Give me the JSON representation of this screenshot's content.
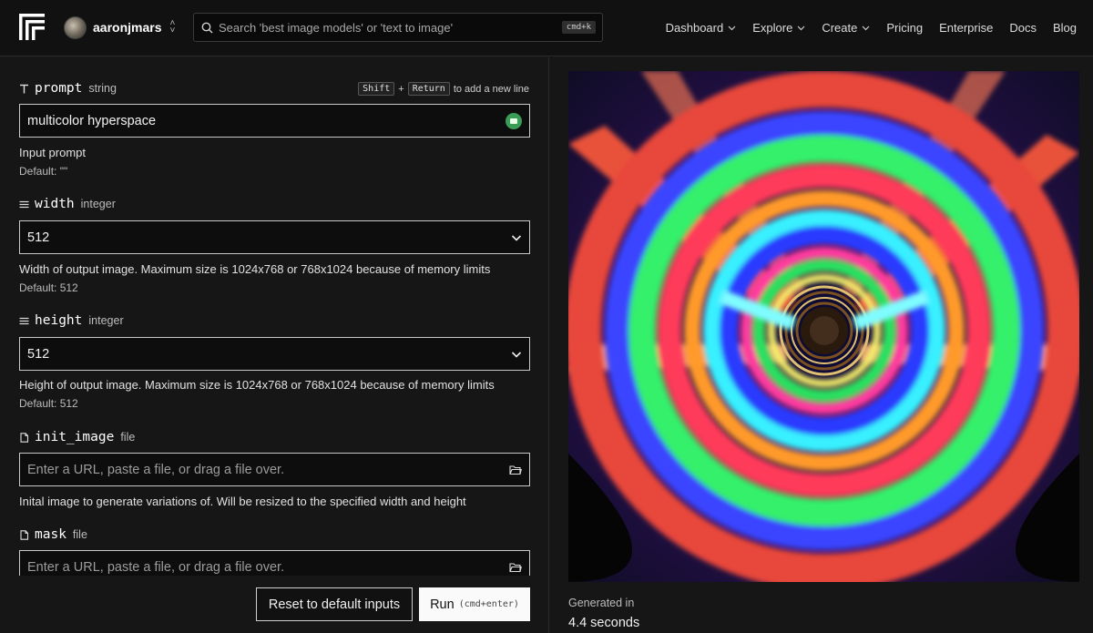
{
  "nav": {
    "username": "aaronjmars",
    "search_placeholder": "Search 'best image models' or 'text to image'",
    "search_shortcut": "cmd+k",
    "links": [
      {
        "label": "Dashboard",
        "has_menu": true
      },
      {
        "label": "Explore",
        "has_menu": true
      },
      {
        "label": "Create",
        "has_menu": true
      },
      {
        "label": "Pricing",
        "has_menu": false
      },
      {
        "label": "Enterprise",
        "has_menu": false
      },
      {
        "label": "Docs",
        "has_menu": false
      },
      {
        "label": "Blog",
        "has_menu": false
      }
    ]
  },
  "form": {
    "newline_hint": {
      "key1": "Shift",
      "plus": "+",
      "key2": "Return",
      "text": "to add a new line"
    },
    "prompt": {
      "name": "prompt",
      "type": "string",
      "value": "multicolor hyperspace",
      "description": "Input prompt",
      "default": "Default: \"\""
    },
    "width": {
      "name": "width",
      "type": "integer",
      "value": "512",
      "description": "Width of output image. Maximum size is 1024x768 or 768x1024 because of memory limits",
      "default": "Default: 512"
    },
    "height": {
      "name": "height",
      "type": "integer",
      "value": "512",
      "description": "Height of output image. Maximum size is 1024x768 or 768x1024 because of memory limits",
      "default": "Default: 512"
    },
    "init_image": {
      "name": "init_image",
      "type": "file",
      "placeholder": "Enter a URL, paste a file, or drag a file over.",
      "description": "Inital image to generate variations of. Will be resized to the specified width and height"
    },
    "mask": {
      "name": "mask",
      "type": "file",
      "placeholder": "Enter a URL, paste a file, or drag a file over."
    }
  },
  "actions": {
    "reset_label": "Reset to default inputs",
    "run_label": "Run",
    "run_shortcut": "(cmd+enter)"
  },
  "output": {
    "generated_label": "Generated in",
    "generated_value": "4.4 seconds"
  },
  "icons": {
    "logo": "replicate-logo-icon",
    "text_field": "text-type-icon",
    "number_field": "list-lines-icon",
    "file_field": "file-icon",
    "folder": "folder-open-icon",
    "search": "search-icon",
    "chevron": "chevron-down-icon"
  },
  "colors": {
    "background": "#161616",
    "nav_background": "#111111",
    "run_button": "#fafafa",
    "ai_badge": "#3a9c57"
  }
}
